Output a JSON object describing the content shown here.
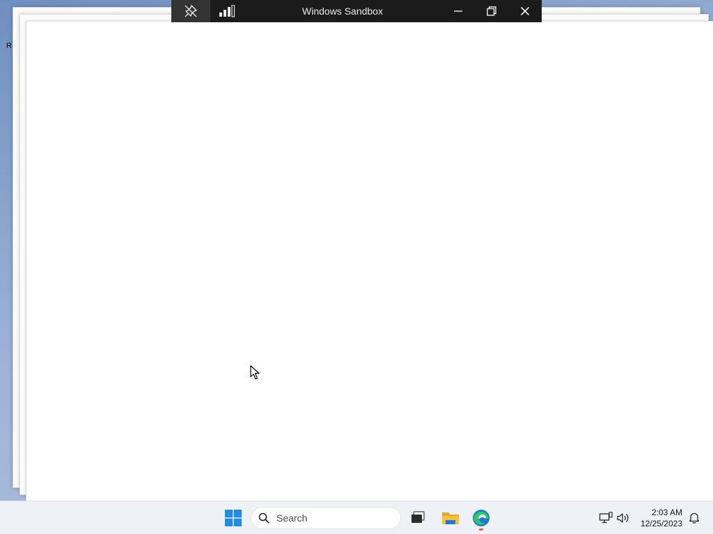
{
  "desktop": {
    "edge_letter": "R"
  },
  "connection_bar": {
    "title": "Windows Sandbox",
    "pin_icon": "pin-off-icon",
    "signal_icon": "signal-bars-icon",
    "minimize_icon": "minimize-icon",
    "restore_icon": "restore-icon",
    "close_icon": "close-icon",
    "background": "#1b1b1b"
  },
  "taskbar": {
    "search_placeholder": "Search",
    "apps": [
      {
        "name": "Task View",
        "icon": "task-view-icon"
      },
      {
        "name": "File Explorer",
        "icon": "folder-icon"
      },
      {
        "name": "Microsoft Edge",
        "icon": "edge-icon"
      }
    ],
    "tray": {
      "network_icon": "network-icon",
      "volume_icon": "volume-icon",
      "notification_icon": "bell-icon"
    },
    "clock": {
      "time": "2:03 AM",
      "date": "12/25/2023"
    }
  },
  "colors": {
    "windows_blue": "#1f8ce6",
    "folder_yellow": "#f7c23b",
    "edge_blue": "#1f7ad6",
    "edge_green": "#34c26a",
    "taskbar_bg": "#eef2f6"
  }
}
